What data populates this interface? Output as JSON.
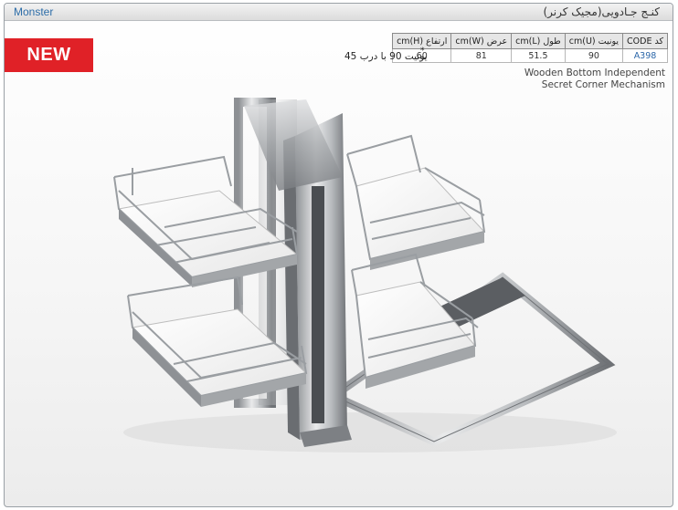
{
  "header": {
    "brand": "Monster",
    "title": "کنـج جـادویی(مجیک کرنر)"
  },
  "badge": {
    "label": "NEW"
  },
  "specs": {
    "columns": [
      "کد CODE",
      "یونیت (U)cm",
      "طول (L)cm",
      "عرض (W)cm",
      "ارتفاع (H)cm"
    ],
    "row": [
      "A398",
      "90",
      "51.5",
      "81",
      "60"
    ]
  },
  "note": {
    "star": "*",
    "text": "یونیت 90 با درب 45"
  },
  "description": {
    "line1": "Wooden Bottom Independent",
    "line2": "Secret Corner Mechanism"
  },
  "colors": {
    "brand": "#2d6da8",
    "badge": "#e02127",
    "code": "#2c67a9"
  }
}
